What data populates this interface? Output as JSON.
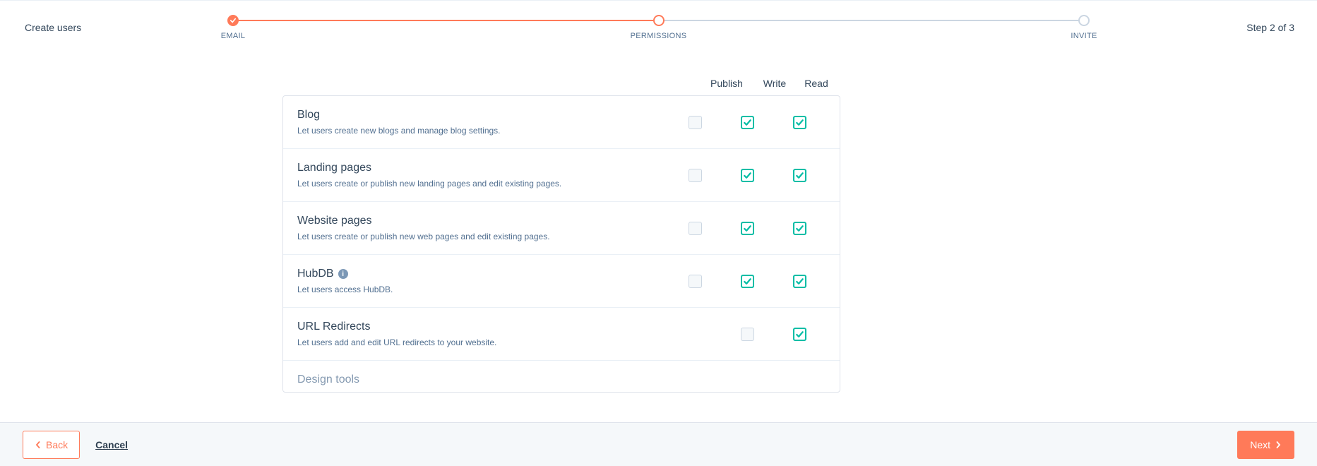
{
  "header": {
    "title": "Create users",
    "step_text": "Step 2 of 3",
    "steps": [
      "EMAIL",
      "PERMISSIONS",
      "INVITE"
    ]
  },
  "columns": {
    "publish": "Publish",
    "write": "Write",
    "read": "Read"
  },
  "permissions": [
    {
      "title": "Blog",
      "desc": "Let users create new blogs and manage blog settings.",
      "has_info": false,
      "cells": {
        "publish": "off",
        "write": "on",
        "read": "on"
      }
    },
    {
      "title": "Landing pages",
      "desc": "Let users create or publish new landing pages and edit existing pages.",
      "has_info": false,
      "cells": {
        "publish": "off",
        "write": "on",
        "read": "on"
      }
    },
    {
      "title": "Website pages",
      "desc": "Let users create or publish new web pages and edit existing pages.",
      "has_info": false,
      "cells": {
        "publish": "off",
        "write": "on",
        "read": "on"
      }
    },
    {
      "title": "HubDB",
      "desc": "Let users access HubDB.",
      "has_info": true,
      "cells": {
        "publish": "off",
        "write": "on",
        "read": "on"
      }
    },
    {
      "title": "URL Redirects",
      "desc": "Let users add and edit URL redirects to your website.",
      "has_info": false,
      "cells": {
        "publish": null,
        "write": "off",
        "read": "on"
      }
    }
  ],
  "partial_row": {
    "title": "Design tools"
  },
  "footer": {
    "back": "Back",
    "cancel": "Cancel",
    "next": "Next"
  }
}
